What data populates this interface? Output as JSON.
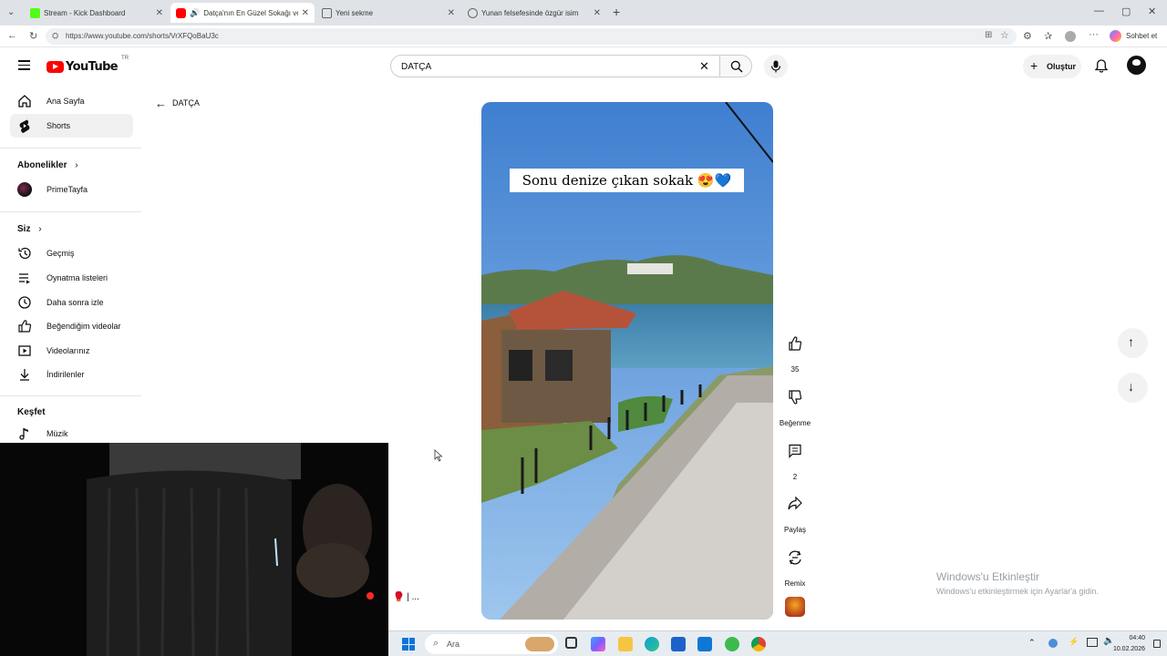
{
  "browser": {
    "tabs": [
      {
        "title": "Stream - Kick Dashboard",
        "icon": "kick-icon",
        "color": "#53fc18"
      },
      {
        "title": "Datça'nın En Güzel Sokağı ve",
        "icon": "youtube-icon",
        "color": "#ff0000"
      },
      {
        "title": "Yeni sekme",
        "icon": "new-tab-icon",
        "color": "#666666"
      },
      {
        "title": "Yunan felsefesinde özgür isim",
        "icon": "site-icon",
        "color": "#666666"
      }
    ],
    "url": "https://www.youtube.com/shorts/VrXFQoBaU3c",
    "copilot_label": "Sohbet et"
  },
  "header": {
    "logo": "YouTube",
    "region": "TR",
    "search_value": "DATÇA",
    "create_label": "Oluştur"
  },
  "sidebar": {
    "main": [
      {
        "label": "Ana Sayfa",
        "icon": "home-icon"
      },
      {
        "label": "Shorts",
        "icon": "shorts-icon"
      }
    ],
    "subs_heading": "Abonelikler",
    "subs": [
      {
        "label": "PrimeTayfa",
        "icon": "channel-avatar"
      }
    ],
    "you_heading": "Siz",
    "you": [
      {
        "label": "Geçmiş",
        "icon": "history-icon"
      },
      {
        "label": "Oynatma listeleri",
        "icon": "playlist-icon"
      },
      {
        "label": "Daha sonra izle",
        "icon": "clock-icon"
      },
      {
        "label": "Beğendiğim videolar",
        "icon": "like-icon"
      },
      {
        "label": "Videolarınız",
        "icon": "video-icon"
      },
      {
        "label": "İndirilenler",
        "icon": "download-icon"
      }
    ],
    "explore_heading": "Keşfet",
    "explore": [
      {
        "label": "Müzik",
        "icon": "music-icon"
      }
    ]
  },
  "back": {
    "label": "DATÇA"
  },
  "video": {
    "caption": "Sonu denize çıkan sokak 😍💙"
  },
  "actions": {
    "likes": "35",
    "dislike_label": "Beğenme",
    "comments": "2",
    "share_label": "Paylaş",
    "remix_label": "Remix"
  },
  "overlay_text": "🥊 | ...",
  "taskbar": {
    "search_placeholder": "Ara",
    "time": "04:40",
    "date": "10.02.2026"
  },
  "watermark": {
    "line1": "Windows'u Etkinleştir",
    "line2": "Windows'u etkinleştirmek için Ayarlar'a gidin."
  }
}
